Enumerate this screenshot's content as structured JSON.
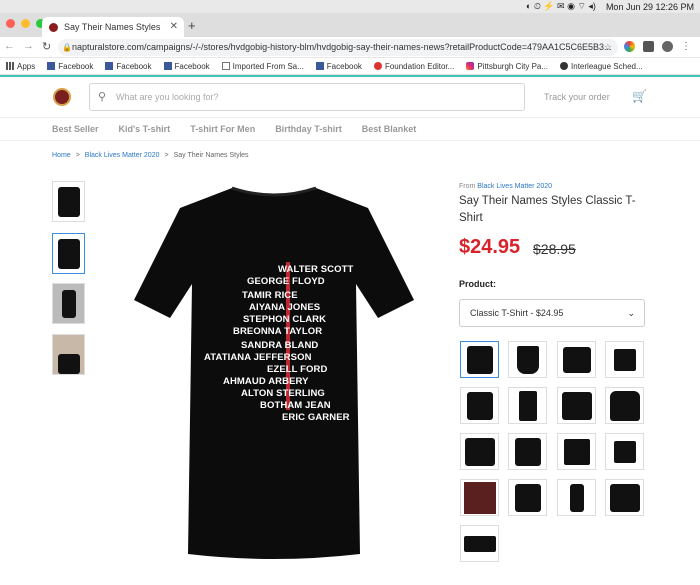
{
  "menubar": {
    "datetime": "Mon Jun 29  12:26 PM"
  },
  "browser": {
    "tab_title": "Say Their Names Styles",
    "url": "napturalstore.com/campaigns/-/-/stores/hvdgobig-history-blm/hvdgobig-say-their-names-news?retailProductCode=479AA1C5C6E5B3..."
  },
  "bookmarks": [
    "Apps",
    "Facebook",
    "Facebook",
    "Facebook",
    "Imported From Sa...",
    "Facebook",
    "Foundation Editor...",
    "Pittsburgh City Pa...",
    "Interleague Sched..."
  ],
  "header": {
    "search_placeholder": "What are you looking for?",
    "track_order": "Track your order"
  },
  "categories": [
    "Best Seller",
    "Kid's T-shirt",
    "T-shirt For Men",
    "Birthday T-shirt",
    "Best Blanket"
  ],
  "breadcrumb": {
    "home": "Home",
    "collection": "Black Lives Matter 2020",
    "current": "Say Their Names Styles",
    "sep": ">"
  },
  "shirt_names": [
    "WALTER SCOTT",
    "GEORGE FLOYD",
    "TAMIR RICE",
    "AIYANA JONES",
    "STEPHON CLARK",
    "BREONNA TAYLOR",
    "SANDRA BLAND",
    "ATATIANA JEFFERSON",
    "EZELL FORD",
    "AHMAUD ARBERY",
    "ALTON STERLING",
    "BOTHAM JEAN",
    "ERIC GARNER"
  ],
  "product": {
    "from_label": "From",
    "from_store": "Black Lives Matter 2020",
    "title": "Say Their Names Styles Classic T-Shirt",
    "price": "$24.95",
    "old_price": "$28.95",
    "product_label": "Product:",
    "selected_option": "Classic T-Shirt - $24.95"
  },
  "colors": {
    "accent_teal": "#3fc4b1",
    "price_red": "#d8232a",
    "link_blue": "#2a78c6"
  }
}
